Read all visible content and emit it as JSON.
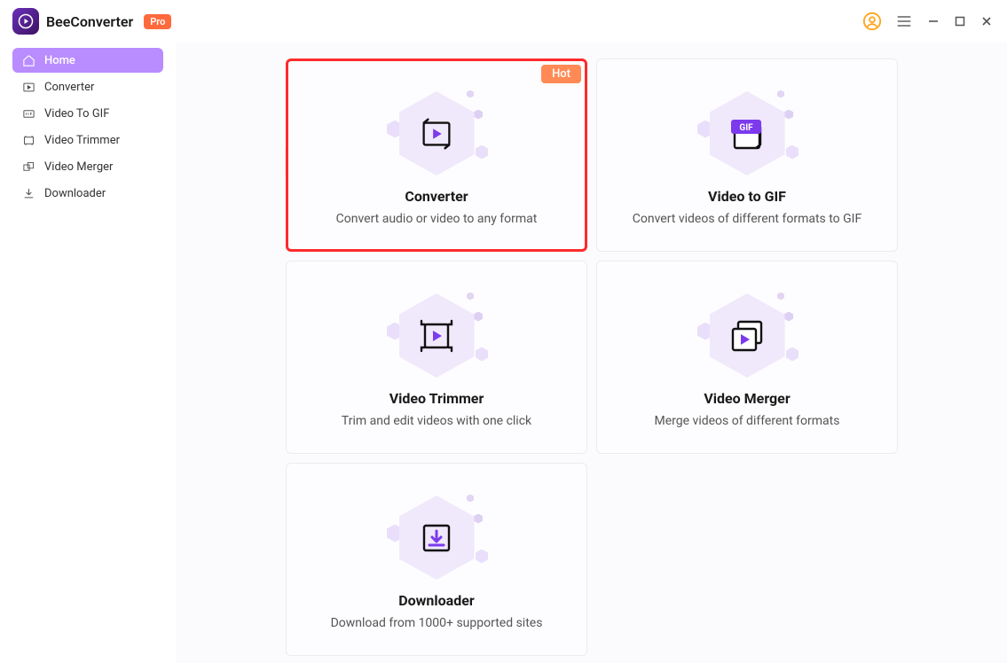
{
  "app": {
    "name": "BeeConverter",
    "badge": "Pro"
  },
  "sidebar": {
    "items": [
      {
        "label": "Home",
        "active": true
      },
      {
        "label": "Converter",
        "active": false
      },
      {
        "label": "Video To GIF",
        "active": false
      },
      {
        "label": "Video Trimmer",
        "active": false
      },
      {
        "label": "Video Merger",
        "active": false
      },
      {
        "label": "Downloader",
        "active": false
      }
    ]
  },
  "cards": {
    "hot_label": "Hot",
    "gif_badge": "GIF",
    "items": [
      {
        "title": "Converter",
        "desc": "Convert audio or video to any format",
        "hot": true
      },
      {
        "title": "Video to GIF",
        "desc": "Convert videos of different formats to GIF",
        "hot": false
      },
      {
        "title": "Video Trimmer",
        "desc": "Trim and edit videos with one click",
        "hot": false
      },
      {
        "title": "Video Merger",
        "desc": "Merge videos of different formats",
        "hot": false
      },
      {
        "title": "Downloader",
        "desc": "Download from 1000+ supported sites",
        "hot": false
      }
    ]
  }
}
